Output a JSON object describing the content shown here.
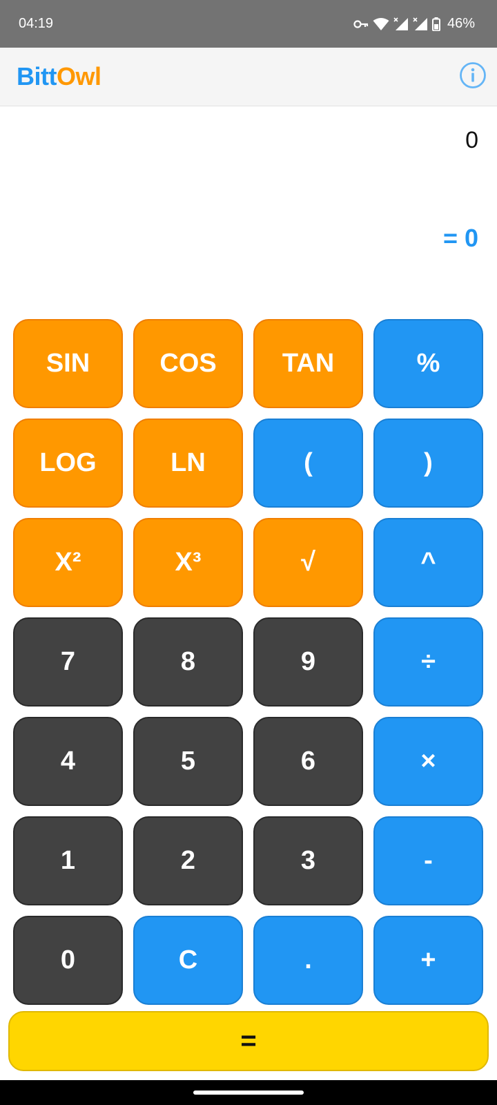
{
  "status_bar": {
    "time": "04:19",
    "battery": "46%",
    "icons": [
      "vpn-key-icon",
      "wifi-icon",
      "signal-icon",
      "signal-icon",
      "battery-icon"
    ]
  },
  "app_bar": {
    "logo_part1": "Bitt",
    "logo_part2": "Owl",
    "info_icon": "info-icon",
    "colors": {
      "blue": "#2196f3",
      "orange": "#ff9800"
    }
  },
  "display": {
    "expression": "0",
    "result": "= 0"
  },
  "keys": {
    "sin": "SIN",
    "cos": "COS",
    "tan": "TAN",
    "percent": "%",
    "log": "LOG",
    "ln": "LN",
    "open_paren": "(",
    "close_paren": ")",
    "square": "X²",
    "cube": "X³",
    "sqrt": "√",
    "power": "^",
    "seven": "7",
    "eight": "8",
    "nine": "9",
    "divide": "÷",
    "four": "4",
    "five": "5",
    "six": "6",
    "multiply": "×",
    "one": "1",
    "two": "2",
    "three": "3",
    "minus": "-",
    "zero": "0",
    "clear": "C",
    "decimal": ".",
    "plus": "+",
    "equals": "="
  },
  "colors": {
    "function_key": "#ff9800",
    "operator_key": "#2196f3",
    "digit_key": "#424242",
    "equals_key": "#ffd600"
  }
}
